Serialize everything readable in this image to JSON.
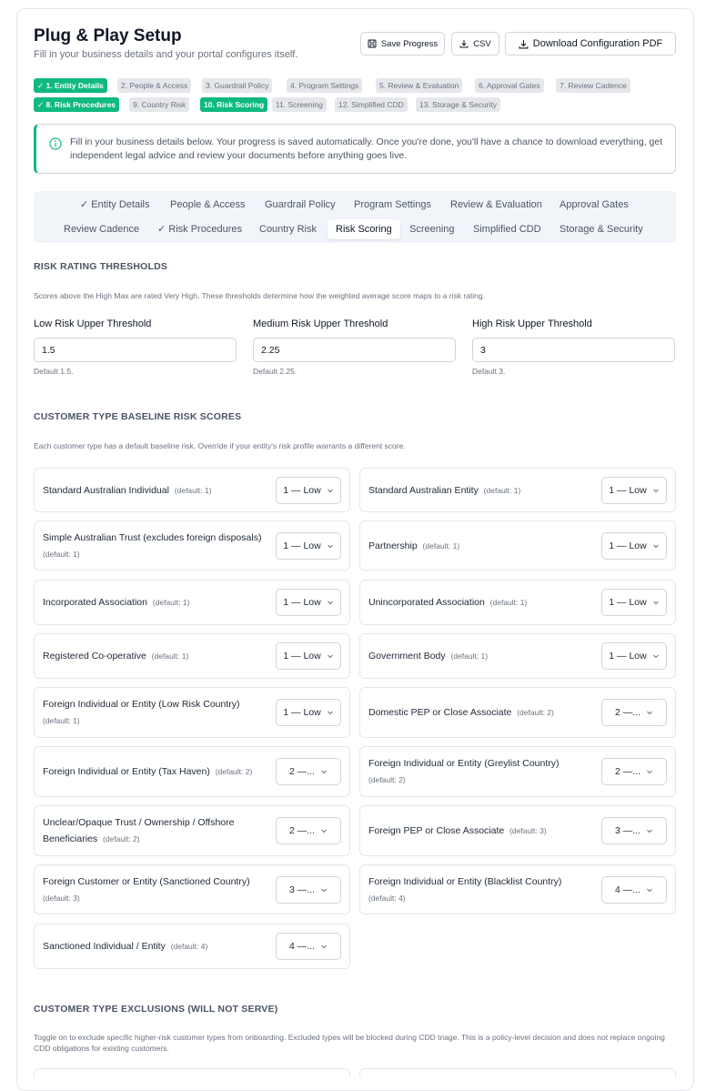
{
  "header": {
    "title": "Plug & Play Setup",
    "subtitle": "Fill in your business details and your portal configures itself."
  },
  "actions": {
    "save_label": "Save Progress",
    "csv_label": "CSV",
    "pdf_label": "Download Configuration PDF"
  },
  "steps": [
    {
      "label": "✓ 1. Entity Details",
      "state": "done"
    },
    {
      "label": "2. People & Access",
      "state": "todo"
    },
    {
      "label": "3. Guardrail Policy",
      "state": "todo"
    },
    {
      "label": "4. Program Settings",
      "state": "todo"
    },
    {
      "label": "5. Review & Evaluation",
      "state": "todo"
    },
    {
      "label": "6. Approval Gates",
      "state": "todo"
    },
    {
      "label": "7. Review Cadence",
      "state": "todo"
    },
    {
      "label": "✓ 8. Risk Procedures",
      "state": "done"
    },
    {
      "label": "9. Country Risk",
      "state": "todo"
    },
    {
      "label": "10. Risk Scoring",
      "state": "active"
    },
    {
      "label": "11. Screening",
      "state": "todo"
    },
    {
      "label": "12. Simplified CDD",
      "state": "todo"
    },
    {
      "label": "13. Storage & Security",
      "state": "todo"
    }
  ],
  "info": {
    "text": "Fill in your business details below. Your progress is saved automatically. Once you're done, you'll have a chance to download everything, get independent legal advice and review your documents before anything goes live."
  },
  "tabs": [
    {
      "label": "✓ Entity Details"
    },
    {
      "label": "People & Access"
    },
    {
      "label": "Guardrail Policy"
    },
    {
      "label": "Program Settings"
    },
    {
      "label": "Review & Evaluation"
    },
    {
      "label": "Approval Gates"
    },
    {
      "label": "Review Cadence"
    },
    {
      "label": "✓ Risk Procedures"
    },
    {
      "label": "Country Risk"
    },
    {
      "label": "Risk Scoring",
      "active": true
    },
    {
      "label": "Screening"
    },
    {
      "label": "Simplified CDD"
    },
    {
      "label": "Storage & Security"
    }
  ],
  "thresholds": {
    "heading": "RISK RATING THRESHOLDS",
    "description": "Scores above the High Max are rated Very High. These thresholds determine how the weighted average score maps to a risk rating.",
    "fields": [
      {
        "label": "Low Risk Upper Threshold",
        "value": "1.5",
        "hint": "Default 1.5."
      },
      {
        "label": "Medium Risk Upper Threshold",
        "value": "2.25",
        "hint": "Default 2.25."
      },
      {
        "label": "High Risk Upper Threshold",
        "value": "3",
        "hint": "Default 3."
      }
    ]
  },
  "baseline": {
    "heading": "CUSTOMER TYPE BASELINE RISK SCORES",
    "description": "Each customer type has a default baseline risk. Override if your entity's risk profile warrants a different score.",
    "items": [
      {
        "label": "Standard Australian Individual",
        "default": "(default: 1)",
        "value": "1 — Low"
      },
      {
        "label": "Standard Australian Entity",
        "default": "(default: 1)",
        "value": "1 — Low"
      },
      {
        "label": "Simple Australian Trust (excludes foreign disposals)",
        "default": "(default: 1)",
        "value": "1 — Low"
      },
      {
        "label": "Partnership",
        "default": "(default: 1)",
        "value": "1 — Low"
      },
      {
        "label": "Incorporated Association",
        "default": "(default: 1)",
        "value": "1 — Low"
      },
      {
        "label": "Unincorporated Association",
        "default": "(default: 1)",
        "value": "1 — Low"
      },
      {
        "label": "Registered Co-operative",
        "default": "(default: 1)",
        "value": "1 — Low"
      },
      {
        "label": "Government Body",
        "default": "(default: 1)",
        "value": "1 — Low"
      },
      {
        "label": "Foreign Individual or Entity (Low Risk Country)",
        "default": "(default: 1)",
        "value": "1 — Low"
      },
      {
        "label": "Domestic PEP or Close Associate",
        "default": "(default: 2)",
        "value": "2 —..."
      },
      {
        "label": "Foreign Individual or Entity (Tax Haven)",
        "default": "(default: 2)",
        "value": "2 —..."
      },
      {
        "label": "Foreign Individual or Entity (Greylist Country)",
        "default": "(default: 2)",
        "value": "2 —..."
      },
      {
        "label": "Unclear/Opaque Trust / Ownership / Offshore Beneficiaries",
        "default": "(default: 2)",
        "value": "2 —..."
      },
      {
        "label": "Foreign PEP or Close Associate",
        "default": "(default: 3)",
        "value": "3 —..."
      },
      {
        "label": "Foreign Customer or Entity (Sanctioned Country)",
        "default": "(default: 3)",
        "value": "3 —..."
      },
      {
        "label": "Foreign Individual or Entity (Blacklist Country)",
        "default": "(default: 4)",
        "value": "4 —..."
      },
      {
        "label": "Sanctioned Individual / Entity",
        "default": "(default: 4)",
        "value": "4 —..."
      }
    ]
  },
  "exclusions": {
    "heading": "CUSTOMER TYPE EXCLUSIONS (WILL NOT SERVE)",
    "description": "Toggle on to exclude specific higher-risk customer types from onboarding. Excluded types will be blocked during CDD triage. This is a policy-level decision and does not replace ongoing CDD obligations for existing customers."
  },
  "colors": {
    "accent": "#10b981",
    "muted_chip": "#e5e7eb",
    "tabs_bg": "#f1f5f9"
  }
}
